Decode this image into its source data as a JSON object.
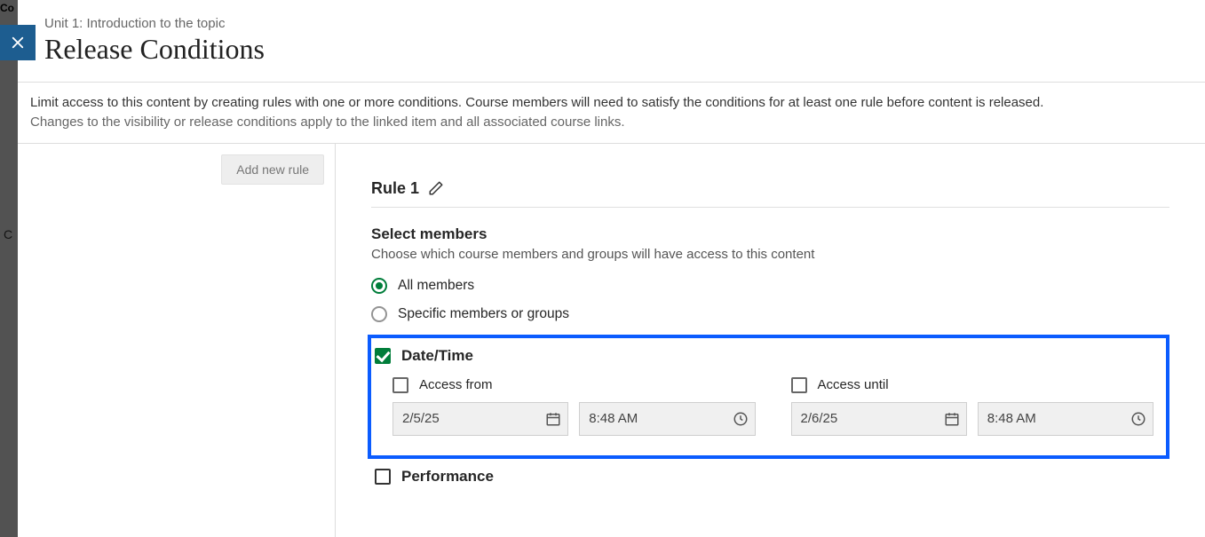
{
  "breadcrumb": "Unit 1: Introduction to the topic",
  "page_title": "Release Conditions",
  "intro_line1": "Limit access to this content by creating rules with one or more conditions. Course members will need to satisfy the conditions for at least one rule before content is released.",
  "intro_line2": "Changes to the visibility or release conditions apply to the linked item and all associated course links.",
  "sidebar": {
    "add_rule_label": "Add new rule"
  },
  "rule": {
    "title": "Rule 1"
  },
  "members": {
    "section_title": "Select members",
    "section_sub": "Choose which course members and groups will have access to this content",
    "option_all": "All members",
    "option_specific": "Specific members or groups",
    "selected": "all"
  },
  "datetime": {
    "section_label": "Date/Time",
    "checked": true,
    "from": {
      "label": "Access from",
      "enabled": false,
      "date": "2/5/25",
      "time": "8:48 AM"
    },
    "until": {
      "label": "Access until",
      "enabled": false,
      "date": "2/6/25",
      "time": "8:48 AM"
    }
  },
  "performance": {
    "section_label": "Performance",
    "checked": false
  }
}
